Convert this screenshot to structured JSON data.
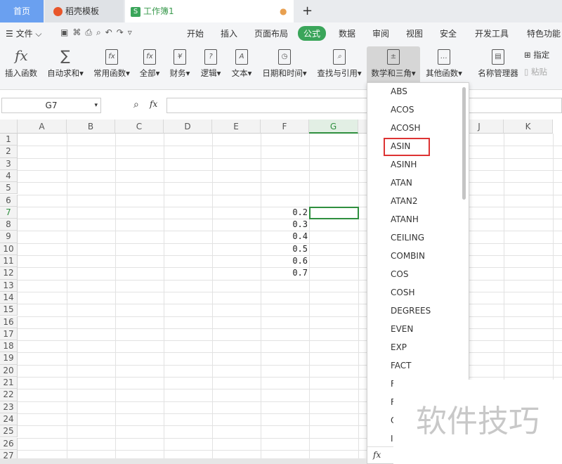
{
  "tabs": {
    "home": "首页",
    "template": "稻壳模板",
    "workbook": "工作簿1",
    "add": "+"
  },
  "menu": {
    "file": "文件",
    "items": [
      "开始",
      "插入",
      "页面布局",
      "公式",
      "数据",
      "审阅",
      "视图",
      "安全",
      "开发工具",
      "特色功能"
    ]
  },
  "ribbon": [
    "插入函数",
    "自动求和",
    "常用函数",
    "全部",
    "财务",
    "逻辑",
    "文本",
    "日期和时间",
    "查找与引用",
    "数学和三角",
    "其他函数",
    "名称管理器"
  ],
  "ribbon_small": [
    "指定",
    "粘贴"
  ],
  "namebox": "G7",
  "fx": "fx",
  "columns": [
    "A",
    "B",
    "C",
    "D",
    "E",
    "F",
    "G",
    "H",
    "I",
    "J",
    "K"
  ],
  "rows": [
    "1",
    "2",
    "3",
    "4",
    "5",
    "6",
    "7",
    "8",
    "9",
    "10",
    "11",
    "12",
    "13",
    "14",
    "15",
    "16",
    "17",
    "18",
    "19",
    "20",
    "21",
    "22",
    "23",
    "24",
    "25",
    "26",
    "27"
  ],
  "cells_F": [
    {
      "row": 7,
      "value": "0.2"
    },
    {
      "row": 8,
      "value": "0.3"
    },
    {
      "row": 9,
      "value": "0.4"
    },
    {
      "row": 10,
      "value": "0.5"
    },
    {
      "row": 11,
      "value": "0.6"
    },
    {
      "row": 12,
      "value": "0.7"
    }
  ],
  "dropdown": {
    "items": [
      "ABS",
      "ACOS",
      "ACOSH",
      "ASIN",
      "ASINH",
      "ATAN",
      "ATAN2",
      "ATANH",
      "CEILING",
      "COMBIN",
      "COS",
      "COSH",
      "DEGREES",
      "EVEN",
      "EXP",
      "FACT",
      "F",
      "F",
      "C",
      "I"
    ],
    "highlighted": "ASIN",
    "footer": "fx"
  },
  "watermark": "软件技巧",
  "accent": "#3aa55a"
}
